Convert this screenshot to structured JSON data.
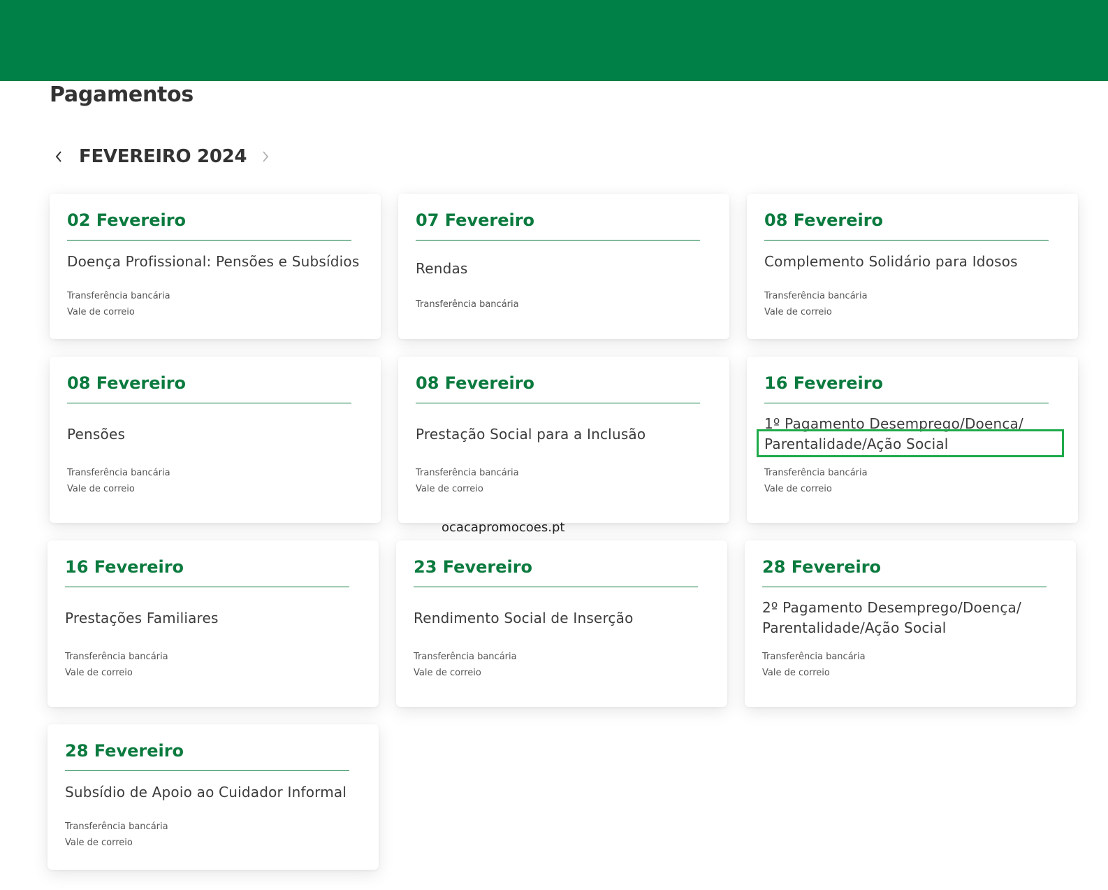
{
  "header": {
    "brand_color": "#008046"
  },
  "page": {
    "title": "Pagamentos"
  },
  "calendar": {
    "month_label": "FEVEREIRO 2024",
    "prev_icon": "chevron-left-icon",
    "next_icon": "chevron-right-icon"
  },
  "cards": [
    {
      "date": "02 Fevereiro",
      "lines": [
        "Doença Profissional: Pensões e Subsídios"
      ],
      "methods": [
        "Transferência bancária",
        "Vale de correio"
      ]
    },
    {
      "date": "07 Fevereiro",
      "lines": [
        "Rendas"
      ],
      "methods": [
        "Transferência bancária"
      ]
    },
    {
      "date": "08 Fevereiro",
      "lines": [
        "Complemento Solidário para Idosos"
      ],
      "methods": [
        "Transferência bancária",
        "Vale de correio"
      ]
    },
    {
      "date": "08 Fevereiro",
      "lines": [
        "Pensões"
      ],
      "methods": [
        "Transferência bancária",
        "Vale de correio"
      ]
    },
    {
      "date": "08 Fevereiro",
      "lines": [
        "Prestação Social para a Inclusão"
      ],
      "methods": [
        "Transferência bancária",
        "Vale de correio"
      ]
    },
    {
      "date": "16 Fevereiro",
      "lines": [
        "1º Pagamento Desemprego/Doença/",
        "Parentalidade/Ação Social"
      ],
      "methods": [
        "Transferência bancária",
        "Vale de correio"
      ]
    },
    {
      "date": "16 Fevereiro",
      "lines": [
        "Prestações Familiares"
      ],
      "methods": [
        "Transferência bancária",
        "Vale de correio"
      ]
    },
    {
      "date": "23 Fevereiro",
      "lines": [
        "Rendimento Social de Inserção"
      ],
      "methods": [
        "Transferência bancária",
        "Vale de correio"
      ]
    },
    {
      "date": "28 Fevereiro",
      "lines": [
        "2º Pagamento Desemprego/Doença/",
        "Parentalidade/Ação Social"
      ],
      "methods": [
        "Transferência bancária",
        "Vale de correio"
      ]
    },
    {
      "date": "28 Fevereiro",
      "lines": [
        "Subsídio de Apoio ao Cuidador Informal"
      ],
      "methods": [
        "Transferência bancária",
        "Vale de correio"
      ]
    }
  ],
  "watermark": "ocacapromocoes.pt",
  "highlight_color": "#1faa4b"
}
